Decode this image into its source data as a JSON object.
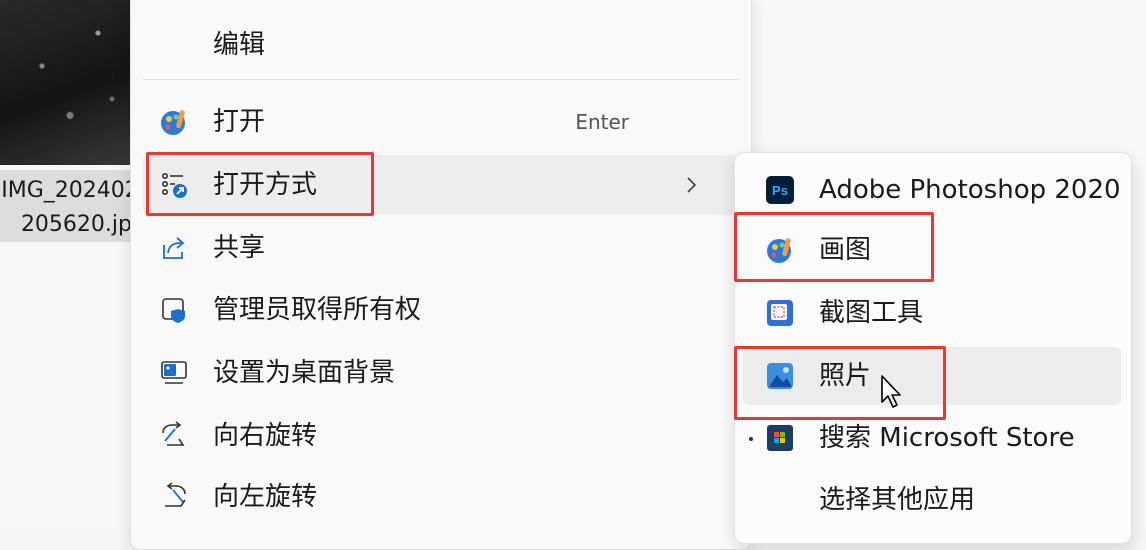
{
  "file": {
    "name_line1": "IMG_202402",
    "name_line2": "205620.jp"
  },
  "menu": {
    "edit_label": "编辑",
    "open_label": "打开",
    "open_shortcut": "Enter",
    "open_with_label": "打开方式",
    "share_label": "共享",
    "take_ownership_label": "管理员取得所有权",
    "set_wallpaper_label": "设置为桌面背景",
    "rotate_right_label": "向右旋转",
    "rotate_left_label": "向左旋转"
  },
  "submenu": {
    "items": [
      {
        "label": "Adobe Photoshop 2020",
        "icon": "photoshop-icon"
      },
      {
        "label": "画图",
        "icon": "paint-icon"
      },
      {
        "label": "截图工具",
        "icon": "snipping-tool-icon"
      },
      {
        "label": "照片",
        "icon": "photos-icon"
      },
      {
        "label": "搜索 Microsoft Store",
        "icon": "store-icon"
      },
      {
        "label": "选择其他应用",
        "icon": ""
      }
    ]
  },
  "colors": {
    "highlight_box": "#e53935",
    "hover_bg": "#ececec",
    "accent_blue": "#1a6fd1"
  }
}
